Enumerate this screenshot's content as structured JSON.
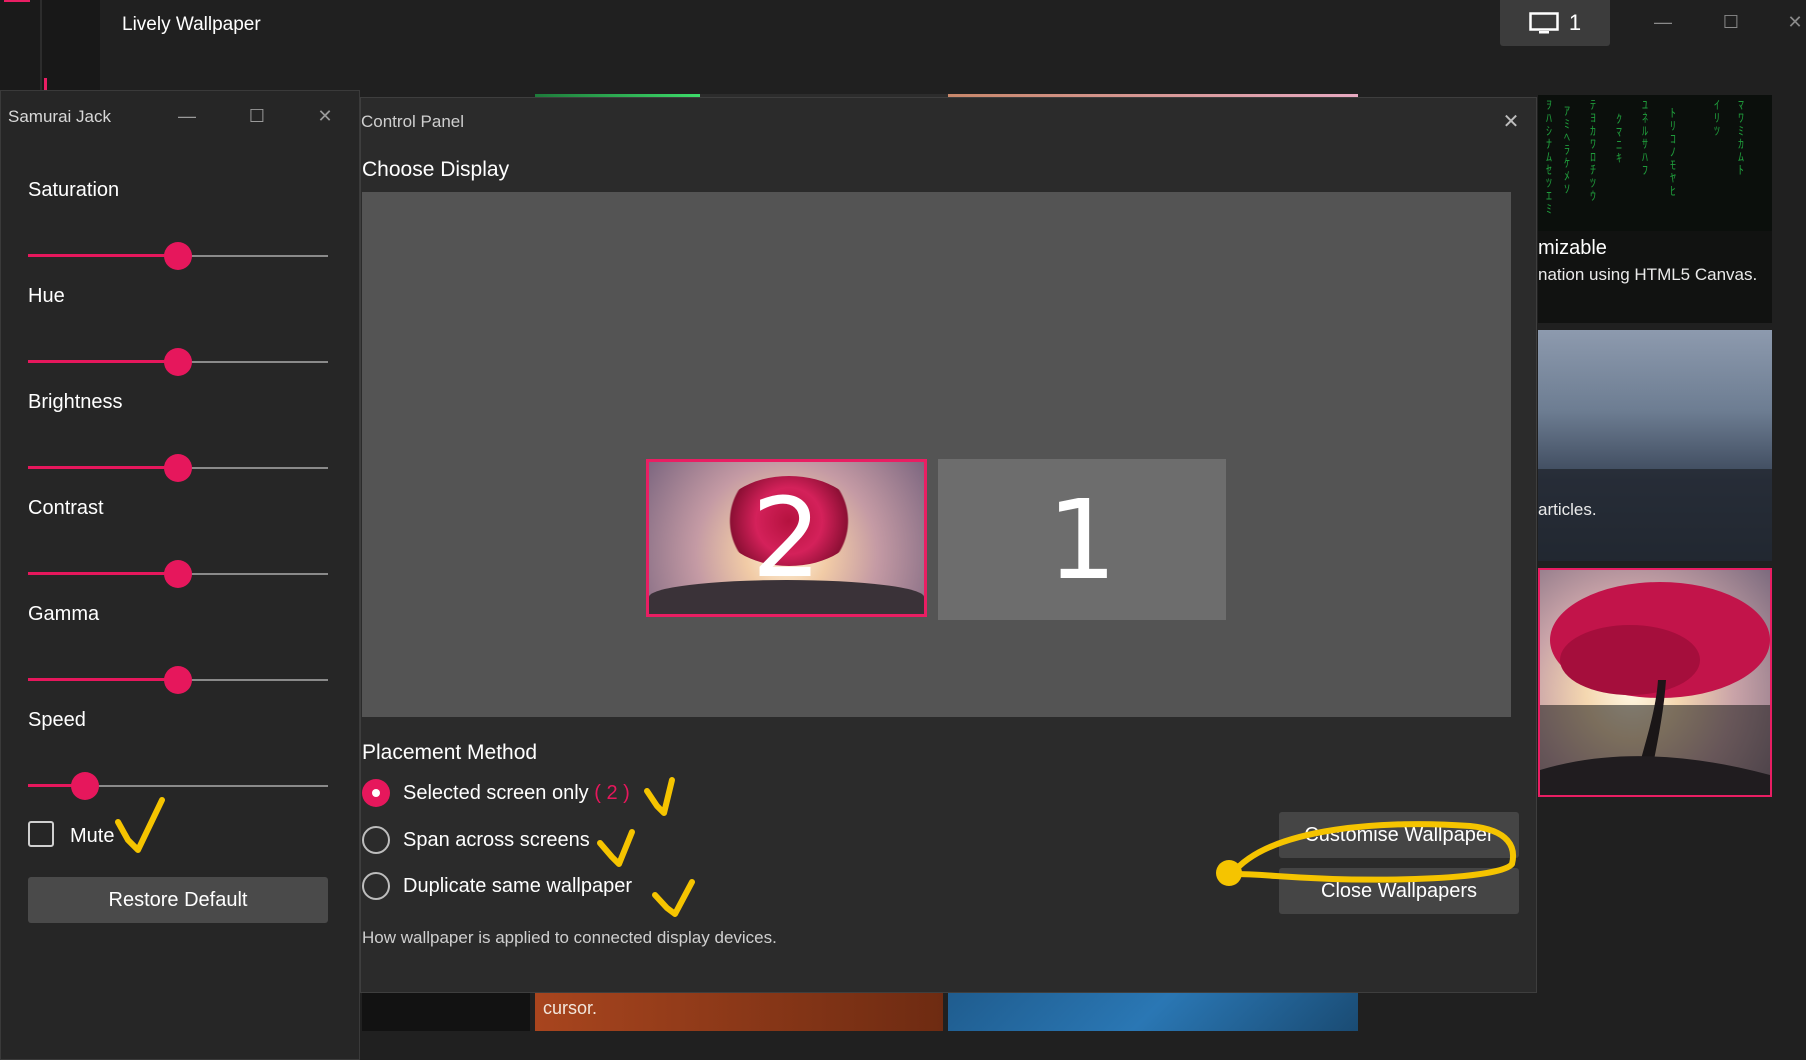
{
  "app": {
    "title": "Lively Wallpaper",
    "display_count": "1"
  },
  "gallery": {
    "matrix_title": "mizable",
    "matrix_desc": "nation using HTML5 Canvas.",
    "rain_desc": "articles.",
    "bottom_desc": "cursor."
  },
  "customise_window": {
    "title": "Samurai Jack",
    "sliders": [
      {
        "label": "Saturation",
        "value": 0.5
      },
      {
        "label": "Hue",
        "value": 0.5
      },
      {
        "label": "Brightness",
        "value": 0.5
      },
      {
        "label": "Contrast",
        "value": 0.5
      },
      {
        "label": "Gamma",
        "value": 0.5
      },
      {
        "label": "Speed",
        "value": 0.19
      }
    ],
    "mute_label": "Mute",
    "mute_checked": false,
    "restore_label": "Restore Default"
  },
  "control_panel": {
    "title": "Control Panel",
    "choose_display_label": "Choose Display",
    "monitors": [
      {
        "label": "2",
        "selected": true
      },
      {
        "label": "1",
        "selected": false
      }
    ],
    "placement_title": "Placement Method",
    "options": [
      {
        "label": "Selected screen only",
        "suffix": "( 2 )",
        "selected": true
      },
      {
        "label": "Span across screens",
        "selected": false
      },
      {
        "label": "Duplicate same wallpaper",
        "selected": false
      }
    ],
    "placement_help": "How wallpaper is applied to connected display devices.",
    "customise_button": "Customise Wallpaper",
    "close_button": "Close Wallpapers"
  },
  "colors": {
    "accent": "#e6175c",
    "annotation": "#f5c400",
    "background": "#202020"
  }
}
